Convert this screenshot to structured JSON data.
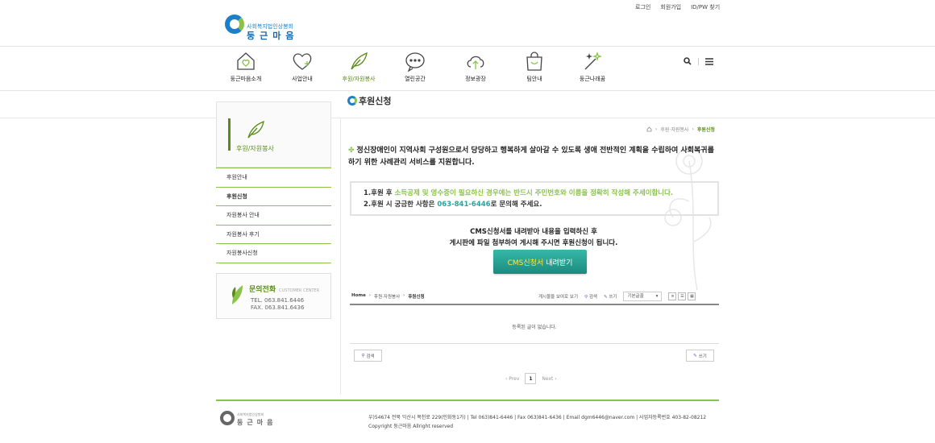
{
  "top_links": [
    "로그인",
    "회원가입",
    "ID/PW 찾기"
  ],
  "logo": {
    "sub": "사회복지법인상봉회",
    "main": "둥근마음"
  },
  "nav": [
    {
      "label": "둥근마음소개",
      "icon": "house-heart-icon"
    },
    {
      "label": "사업안내",
      "icon": "heart-plus-icon"
    },
    {
      "label": "후원/자원봉사",
      "icon": "leaf-icon"
    },
    {
      "label": "열린공간",
      "icon": "chat-bubble-icon"
    },
    {
      "label": "정보광장",
      "icon": "cloud-upload-icon"
    },
    {
      "label": "팀안내",
      "icon": "bag-smile-icon"
    },
    {
      "label": "둥근나래꿈",
      "icon": "magic-wand-icon"
    }
  ],
  "page_title": "후원신청",
  "sidebar": {
    "title": "후원/자원봉사",
    "items": [
      "후원안내",
      "후원신청",
      "자원봉사 안내",
      "자원봉사 후기",
      "자원봉사신청"
    ],
    "contact": {
      "title": "문의전화",
      "sub": "CUSTOMER CENTER",
      "tel": "TEL. 063.841.6446",
      "fax": "FAX. 063.841.6436"
    }
  },
  "breadcrumb": [
    "후원·자원봉사",
    "후원신청"
  ],
  "intro": "정신장애인이 지역사회 구성원으로서 당당하고 행복하게 살아갈 수 있도록 생애 전반적인 계획을 수립하여 사회복귀를 하기 위한 사례관리 서비스를 지원합니다.",
  "notice": {
    "line1_a": "1.후원 후 ",
    "line1_b": "소득공제 및 영수증이 필요하신 경우에는 반드시 주민번호와 이름을 정확히 작성해 주세이합니다.",
    "line2_a": "2.후원 시 궁금한 사항은 ",
    "line2_b": "063-841-6446",
    "line2_c": "로 문의해 주세요."
  },
  "cms": {
    "line1": "CMS신청서를 내려받아 내용을 입력하신 후",
    "line2": "게시판에 파일 첨부하여 게시해 주시면 후원신청이 됩니다.",
    "btn_a": "CMS신청서",
    "btn_b": "내려받기"
  },
  "board": {
    "bc_home": "Home",
    "bc_1": "후원·자원봉사",
    "bc_2": "후원신청",
    "show_label": "게시물을 보여로 보기",
    "search": "검색",
    "write": "쓰기",
    "sort": "기본글꼴",
    "empty": "등록된 글이 없습니다.",
    "prev": "‹ Prev",
    "page": "1",
    "next": "Next ›"
  },
  "footer": {
    "logo_sub": "사회복지법인상봉회",
    "logo_main": "둥근마음",
    "info": "우)54674 전북 익산시 목천로 229(인화동1가) | Tel 063)841-6446 | Fax 063)841-6436 | Email dgm6446@naver.com | 사업자등록번호 403-82-08212",
    "copy": "Copyright 둥근마음 Allright reserved"
  },
  "colors": {
    "green": "#8bc34a",
    "dark_green": "#5a8a1a",
    "blue": "#1c7fc8",
    "teal": "#2ba29d"
  }
}
